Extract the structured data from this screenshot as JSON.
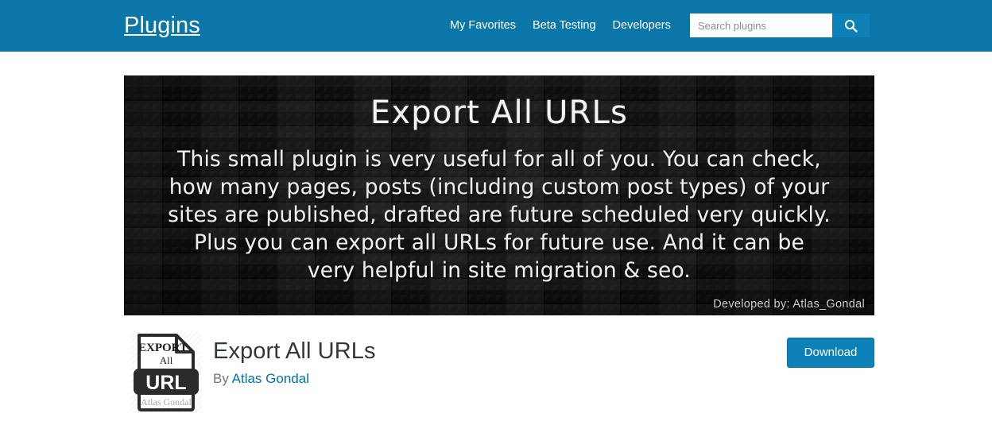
{
  "header": {
    "site_title": "Plugins",
    "nav": [
      {
        "label": "My Favorites"
      },
      {
        "label": "Beta Testing"
      },
      {
        "label": "Developers"
      }
    ],
    "search": {
      "placeholder": "Search plugins",
      "value": "",
      "submit_icon": "search-icon"
    },
    "background_color": "#0b76a8",
    "search_button_color": "#0d81b7"
  },
  "banner": {
    "heading": "Export All URLs",
    "body_lines": [
      "This small plugin is very useful for all of you. You can check,",
      "how many pages, posts (including custom post types) of your",
      "sites are published, drafted are future scheduled very quickly.",
      "Plus you can export all URLs for future use. And it can be",
      "very helpful in site migration & seo."
    ],
    "credit": "Developed by: Atlas_Gondal",
    "background_color": "#0d0d0d"
  },
  "plugin": {
    "icon": {
      "name": "export-all-url-document-icon",
      "line1": "EXPORT",
      "line2": "All",
      "badge": "URL",
      "footer": "Atlas Gondal"
    },
    "name": "Export All URLs",
    "author_prefix": "By",
    "author_name": "Atlas Gondal",
    "author_link_color": "#0073aa",
    "download_label": "Download",
    "download_button_color": "#0c82b8"
  }
}
